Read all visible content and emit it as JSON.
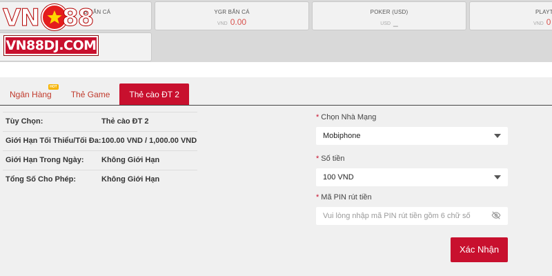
{
  "logo": {
    "vn": "VN",
    "num": "88",
    "domain": "VN88DJ.COM"
  },
  "wallets": [
    {
      "title": "SB BẮN CÁ",
      "currency": "",
      "value": ""
    },
    {
      "title": "YGR BẮN CÁ",
      "currency": "VND",
      "value": "0.00"
    },
    {
      "title": "POKER (USD)",
      "currency": "USD",
      "value": "_"
    },
    {
      "title": "PLAYTE",
      "currency": "VND",
      "value": "0"
    }
  ],
  "tabs": [
    {
      "label": "Ngân Hàng",
      "badge": "HOT"
    },
    {
      "label": "Thẻ Game"
    },
    {
      "label": "Thẻ cào ĐT 2"
    }
  ],
  "info": [
    {
      "key": "Tùy Chọn:",
      "value": "Thẻ cào ĐT 2"
    },
    {
      "key": "Giới Hạn Tối Thiểu/Tối Đa:",
      "value": "100.00 VND / 1,000.00 VND"
    },
    {
      "key": "Giới Hạn Trong Ngày:",
      "value": "Không Giới Hạn"
    },
    {
      "key": "Tổng Số Cho Phép:",
      "value": "Không Giới Hạn"
    }
  ],
  "form": {
    "carrier_label": "Chọn Nhà Mạng",
    "carrier_value": "Mobiphone",
    "amount_label": "Số tiền",
    "amount_value": "100 VND",
    "pin_label": "Mã PIN rút tiền",
    "pin_placeholder": "Vui lòng nhập mã PIN rút tiền gồm 6 chữ số",
    "submit_label": "Xác Nhận"
  },
  "colors": {
    "accent": "#c8102e",
    "amount": "#d9534f",
    "badge": "#f6b400"
  }
}
